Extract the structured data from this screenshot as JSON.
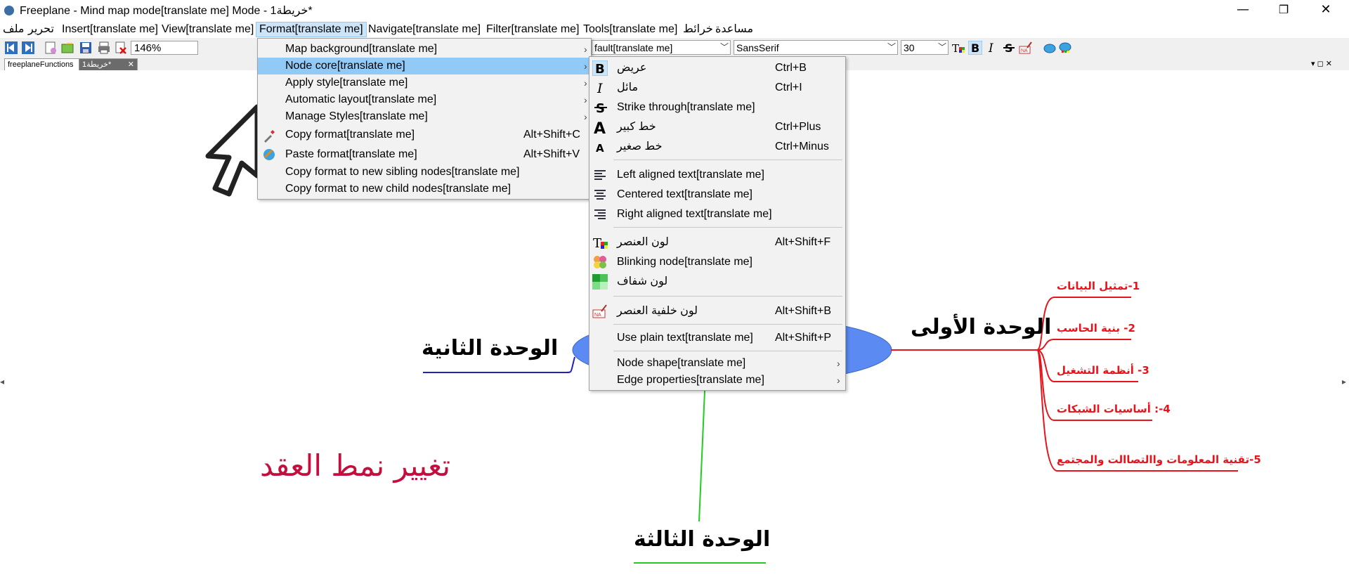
{
  "window": {
    "title": "Freeplane - Mind map mode[translate me] Mode - خريطة1*",
    "minimize_glyph": "—",
    "maximize_glyph": "❐",
    "close_glyph": "✕"
  },
  "menubar": {
    "items": [
      "ملف",
      "تحرير",
      "Insert[translate me]",
      "View[translate me]",
      "Format[translate me]",
      "Navigate[translate me]",
      "Filter[translate me]",
      "Tools[translate me]",
      "خرائط",
      "مساعدة"
    ]
  },
  "toolbar": {
    "zoom": "146%",
    "style_combo": "fault[translate me]",
    "font_combo": "SansSerif",
    "size_combo": "30"
  },
  "tabs": {
    "items": [
      "freeplaneFunctions",
      "خريطة1*"
    ]
  },
  "format_menu": {
    "items": [
      {
        "label": "Map background[translate me]",
        "shortcut": "",
        "submenu": true
      },
      {
        "label": "Node core[translate me]",
        "shortcut": "",
        "submenu": true
      },
      {
        "label": "Apply style[translate me]",
        "shortcut": "",
        "submenu": true
      },
      {
        "label": "Automatic layout[translate me]",
        "shortcut": "",
        "submenu": true
      },
      {
        "label": "Manage Styles[translate me]",
        "shortcut": "",
        "submenu": true
      },
      {
        "label": "Copy format[translate me]",
        "shortcut": "Alt+Shift+C",
        "submenu": false
      },
      {
        "label": "Paste format[translate me]",
        "shortcut": "Alt+Shift+V",
        "submenu": false
      },
      {
        "label": "Copy format to new sibling nodes[translate me]",
        "shortcut": "",
        "submenu": false
      },
      {
        "label": "Copy format to new child nodes[translate me]",
        "shortcut": "",
        "submenu": false
      }
    ]
  },
  "node_core_menu": {
    "items": [
      {
        "icon": "bold-icon",
        "label": "عريض",
        "shortcut": "Ctrl+B"
      },
      {
        "icon": "italic-icon",
        "label": "مائل",
        "shortcut": "Ctrl+I"
      },
      {
        "icon": "strikethrough-icon",
        "label": "Strike through[translate me]",
        "shortcut": ""
      },
      {
        "icon": "font-larger-icon",
        "label": "خط كبير",
        "shortcut": "Ctrl+Plus"
      },
      {
        "icon": "font-smaller-icon",
        "label": "خط صغير",
        "shortcut": "Ctrl+Minus"
      },
      {
        "icon": "align-left-icon",
        "label": "Left aligned text[translate me]",
        "shortcut": ""
      },
      {
        "icon": "align-center-icon",
        "label": "Centered text[translate me]",
        "shortcut": ""
      },
      {
        "icon": "align-right-icon",
        "label": "Right aligned text[translate me]",
        "shortcut": ""
      },
      {
        "icon": "node-color-icon",
        "label": "لون العنصر",
        "shortcut": "Alt+Shift+F"
      },
      {
        "icon": "blinking-node-icon",
        "label": "Blinking node[translate me]",
        "shortcut": ""
      },
      {
        "icon": "transparent-color-icon",
        "label": "لون شفاف",
        "shortcut": ""
      },
      {
        "icon": "node-background-color-icon",
        "label": "لون خلفية العنصر",
        "shortcut": "Alt+Shift+B"
      },
      {
        "icon": "",
        "label": "Use plain text[translate me]",
        "shortcut": "Alt+Shift+P"
      },
      {
        "icon": "",
        "label": "Node shape[translate me]",
        "shortcut": ""
      },
      {
        "icon": "",
        "label": "Edge properties[translate me]",
        "shortcut": ""
      }
    ]
  },
  "mindmap": {
    "unit1": "الوحدة الأولى",
    "unit2": "الوحدة الثانية",
    "unit3": "الوحدة الثالثة",
    "children": [
      "1-تمثيل البيانات",
      "2- بنية الحاسب",
      "3- أنظمة التشغيل",
      "4-: أساسيات الشبكات",
      "5-تقنية المعلومات واالتصاالت والمجتمع"
    ],
    "caption": "تغيير نمط العقد"
  },
  "colors": {
    "root_fill": "#5a8af2",
    "child_text": "#e8131b",
    "caption": "#c40e3e",
    "menu_highlight": "#91c9f7",
    "edge_blue": "#2222bb",
    "edge_green": "#22cc22",
    "edge_red": "#e8131b"
  }
}
